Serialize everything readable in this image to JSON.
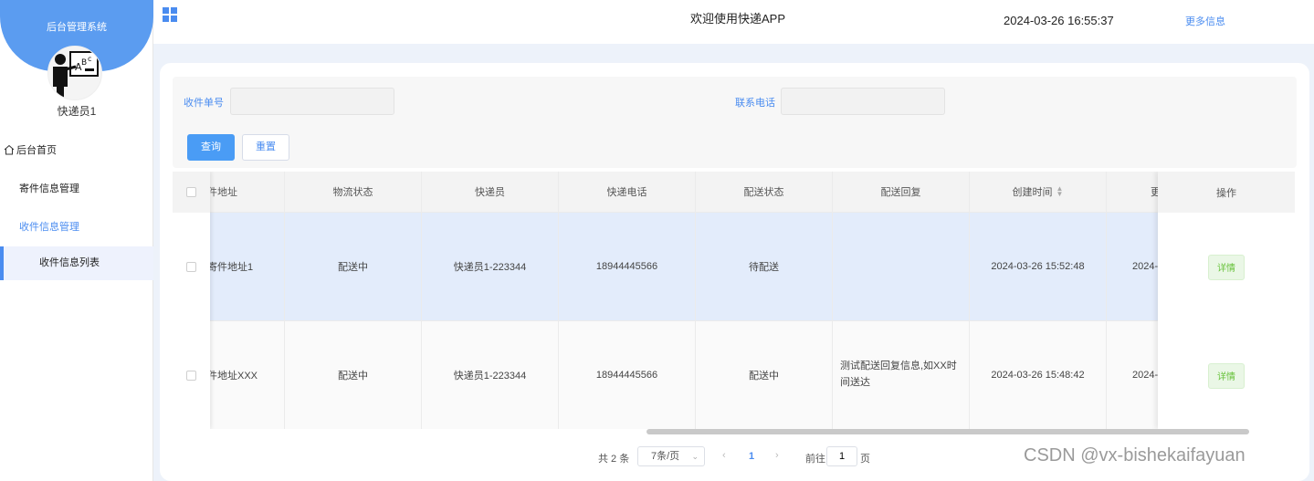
{
  "sidebar": {
    "title": "后台管理系统",
    "user_name": "快递员1",
    "menu": {
      "home": "后台首页",
      "send_mgmt": "寄件信息管理",
      "recv_mgmt": "收件信息管理",
      "recv_list": "收件信息列表"
    }
  },
  "header": {
    "title": "欢迎使用快递APP",
    "datetime": "2024-03-26 16:55:37",
    "more": "更多信息"
  },
  "search": {
    "field1_label": "收件单号",
    "field1_value": "",
    "field2_label": "联系电话",
    "field2_value": "",
    "query_btn": "查询",
    "reset_btn": "重置"
  },
  "table": {
    "columns": [
      "件地址",
      "物流状态",
      "快递员",
      "快递电话",
      "配送状态",
      "配送回复",
      "创建时间",
      "更",
      "操作"
    ],
    "rows": [
      {
        "address": "寄件地址1",
        "logistics": "配送中",
        "courier": "快递员1-223344",
        "phone": "18944445566",
        "delivery": "待配送",
        "reply": "",
        "created": "2024-03-26 15:52:48",
        "updated": "2024-(",
        "action": "详情"
      },
      {
        "address": "件地址XXX",
        "logistics": "配送中",
        "courier": "快递员1-223344",
        "phone": "18944445566",
        "delivery": "配送中",
        "reply": "测试配送回复信息,如XX时间送达",
        "created": "2024-03-26 15:48:42",
        "updated": "2024-(",
        "action": "详情"
      }
    ]
  },
  "pagination": {
    "total": "共 2 条",
    "page_size": "7条/页",
    "prev": "‹",
    "current": "1",
    "next": "›",
    "goto_label": "前往",
    "goto_value": "1",
    "unit": "页"
  },
  "watermark": "CSDN @vx-bishekaifayuan",
  "colors": {
    "accent": "#4a8cf0",
    "banner": "#5b9cf0",
    "row_highlight": "#e3ecfb",
    "detail_green": "#67c23a"
  }
}
